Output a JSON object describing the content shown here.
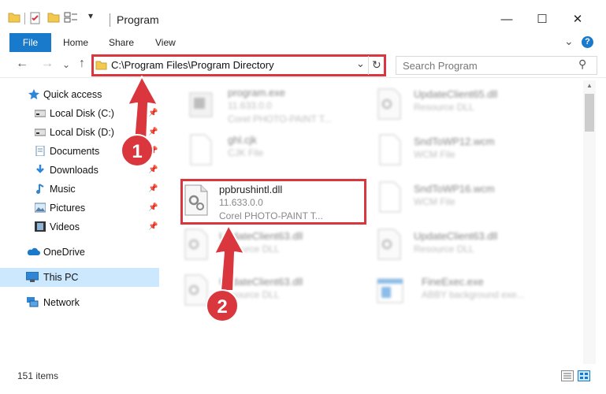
{
  "window": {
    "title": "Program",
    "minimize_glyph": "—",
    "maximize_glyph": "☐",
    "close_glyph": "✕"
  },
  "ribbon": {
    "tabs": [
      {
        "label": "File"
      },
      {
        "label": "Home"
      },
      {
        "label": "Share"
      },
      {
        "label": "View"
      }
    ],
    "help_glyph": "?",
    "expand_glyph": "⌄"
  },
  "nav": {
    "back_glyph": "←",
    "forward_glyph": "→",
    "recent_glyph": "⌄",
    "up_glyph": "↑",
    "address": "C:\\Program Files\\Program Directory",
    "address_dropdown_glyph": "⌄",
    "refresh_glyph": "↻",
    "search_placeholder": "Search Program",
    "search_glyph": "⚲"
  },
  "sidebar": {
    "items": [
      {
        "label": "Quick access",
        "icon": "star-icon",
        "pinned": false
      },
      {
        "label": "Local Disk (C:)",
        "icon": "drive-icon",
        "pinned": true
      },
      {
        "label": "Local Disk (D:)",
        "icon": "drive-icon",
        "pinned": true
      },
      {
        "label": "Documents",
        "icon": "documents-icon",
        "pinned": true
      },
      {
        "label": "Downloads",
        "icon": "download-icon",
        "pinned": true
      },
      {
        "label": "Music",
        "icon": "music-icon",
        "pinned": true
      },
      {
        "label": "Pictures",
        "icon": "pictures-icon",
        "pinned": true
      },
      {
        "label": "Videos",
        "icon": "videos-icon",
        "pinned": true
      },
      {
        "label": "OneDrive",
        "icon": "cloud-icon",
        "pinned": false
      },
      {
        "label": "This PC",
        "icon": "computer-icon",
        "pinned": false,
        "selected": true
      },
      {
        "label": "Network",
        "icon": "network-icon",
        "pinned": false
      }
    ]
  },
  "files": {
    "left_column": [
      {
        "name": "program.exe",
        "line2": "11.633.0.0",
        "line3": "Corel PHOTO-PAINT T...",
        "blurred": true
      },
      {
        "name": "ghl.cjk",
        "line2": "CJK File",
        "line3": "",
        "blurred": true
      },
      {
        "name": "ppbrushintl.dll",
        "line2": "11.633.0.0",
        "line3": "Corel PHOTO-PAINT T...",
        "blurred": false,
        "highlighted": true
      },
      {
        "name": "UpdateClient63.dll",
        "line2": "Resource DLL",
        "line3": "",
        "blurred": true
      },
      {
        "name": "UpdateClient63.dll",
        "line2": "Resource DLL",
        "line3": "",
        "blurred": true
      }
    ],
    "right_column": [
      {
        "name": "UpdateClient65.dll",
        "line2": "Resource DLL",
        "blurred": true
      },
      {
        "name": "SndToWP12.wcm",
        "line2": "WCM File",
        "blurred": true
      },
      {
        "name": "SndToWP16.wcm",
        "line2": "WCM File",
        "blurred": true
      },
      {
        "name": "UpdateClient63.dll",
        "line2": "Resource DLL",
        "blurred": true
      },
      {
        "name": "FineExec.exe",
        "line2": "ABBY background exe...",
        "blurred": true
      }
    ]
  },
  "annotations": {
    "step1": "1",
    "step2": "2",
    "color": "#d9363e"
  },
  "status": {
    "item_count": "151 items"
  },
  "colors": {
    "accent": "#1979ca",
    "selection": "#cce8ff",
    "highlight": "#d9363e"
  }
}
